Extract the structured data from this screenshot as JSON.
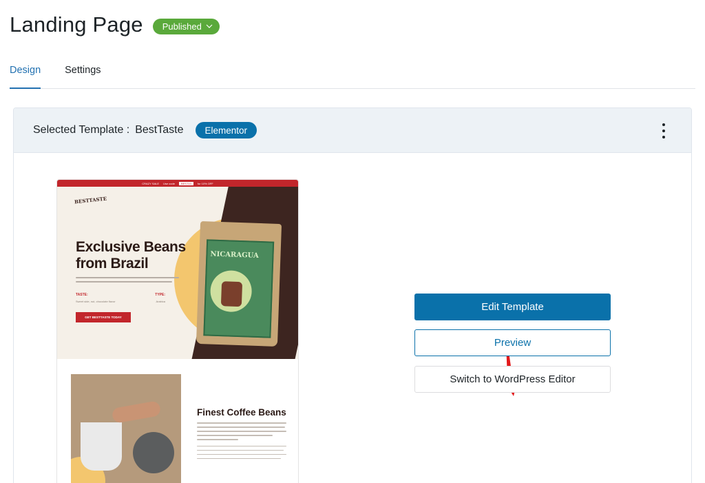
{
  "page": {
    "title": "Landing Page",
    "status": "Published"
  },
  "tabs": [
    {
      "label": "Design",
      "active": true
    },
    {
      "label": "Settings",
      "active": false
    }
  ],
  "template_card": {
    "selected_label": "Selected Template :",
    "template_name": "BestTaste",
    "builder_badge": "Elementor",
    "menu_icon": "more-vertical-icon"
  },
  "preview": {
    "topbar_text": "CRAZY SALE",
    "topbar_promo": "Use code",
    "topbar_code": "BEST10",
    "topbar_suffix": "for 10% OFF",
    "logo": "BESTTASTE",
    "hero_title": "Exclusive Beans from Brazil",
    "meta_taste_label": "TASTE:",
    "meta_type_label": "TYPE:",
    "meta_taste_value": "Sweet side, nut, chocolate flavor",
    "meta_type_value": "Arabica",
    "cta": "GET BESTTASTE TODAY",
    "bag_label": "NICARAGUA",
    "section_title": "Finest Coffee Beans"
  },
  "actions": {
    "edit_label": "Edit Template",
    "preview_label": "Preview",
    "switch_label": "Switch to WordPress Editor"
  },
  "colors": {
    "primary": "#0a71aa",
    "published": "#5aa93b",
    "arrow": "#e3191b",
    "header_bg": "#edf2f6"
  }
}
